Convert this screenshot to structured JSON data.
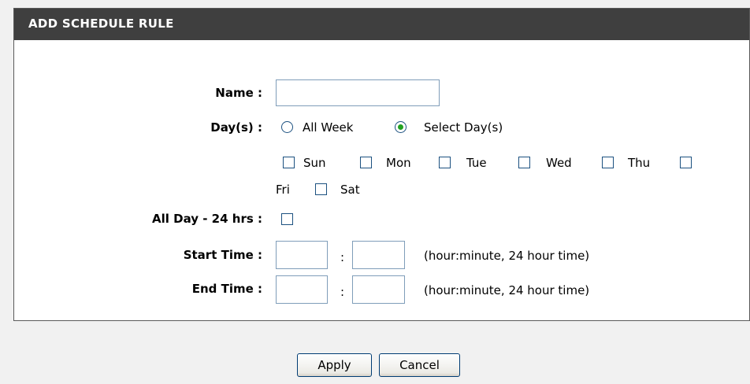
{
  "header": {
    "title": "ADD SCHEDULE RULE"
  },
  "form": {
    "name_label": "Name :",
    "name_value": "",
    "days_label": "Day(s) :",
    "days_options": {
      "all_week": "All Week",
      "select_days": "Select Day(s)"
    },
    "days_selected": "select_days",
    "weekdays": [
      "Sun",
      "Mon",
      "Tue",
      "Wed",
      "Thu",
      "Fri",
      "Sat"
    ],
    "all_day_label": "All Day - 24 hrs :",
    "start_time_label": "Start Time :",
    "end_time_label": "End Time :",
    "time_separator": ":",
    "time_hint": "(hour:minute, 24 hour time)"
  },
  "buttons": {
    "apply": "Apply",
    "cancel": "Cancel"
  },
  "colors": {
    "header_bg": "#3f3f3f",
    "radio_dot": "#21a121",
    "page_bg": "#f1f1f1"
  }
}
